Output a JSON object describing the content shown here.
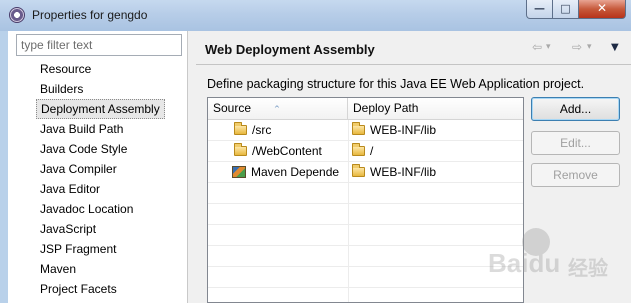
{
  "window": {
    "title": "Properties for gengdo",
    "minimize_glyph": "—",
    "maximize_glyph": "□",
    "close_glyph": "✕"
  },
  "sidebar": {
    "filter_placeholder": "type filter text",
    "items": [
      {
        "label": "Resource"
      },
      {
        "label": "Builders"
      },
      {
        "label": "Deployment Assembly",
        "selected": true
      },
      {
        "label": "Java Build Path"
      },
      {
        "label": "Java Code Style"
      },
      {
        "label": "Java Compiler"
      },
      {
        "label": "Java Editor"
      },
      {
        "label": "Javadoc Location"
      },
      {
        "label": "JavaScript"
      },
      {
        "label": "JSP Fragment"
      },
      {
        "label": "Maven"
      },
      {
        "label": "Project Facets"
      }
    ]
  },
  "page": {
    "title": "Web Deployment Assembly",
    "nav": {
      "back": "⇦",
      "back_menu": "▾",
      "forward": "⇨",
      "forward_menu": "▾",
      "view_menu": "▼"
    },
    "description": "Define packaging structure for this Java EE Web Application project."
  },
  "table": {
    "columns": [
      "Source",
      "Deploy Path"
    ],
    "sort_indicator": "^",
    "rows": [
      {
        "source": "/src",
        "source_icon": "folder-icon",
        "deploy_path": "WEB-INF/lib",
        "deploy_icon": "folder-icon"
      },
      {
        "source": "/WebContent",
        "source_icon": "folder-icon",
        "deploy_path": "/",
        "deploy_icon": "folder-icon"
      },
      {
        "source": "Maven Depende",
        "source_icon": "maven-library-icon",
        "deploy_path": "WEB-INF/lib",
        "deploy_icon": "folder-icon"
      }
    ]
  },
  "buttons": {
    "add": "Add...",
    "edit": "Edit...",
    "remove": "Remove"
  },
  "watermark": {
    "text": "Baidu",
    "sub": "经验"
  }
}
